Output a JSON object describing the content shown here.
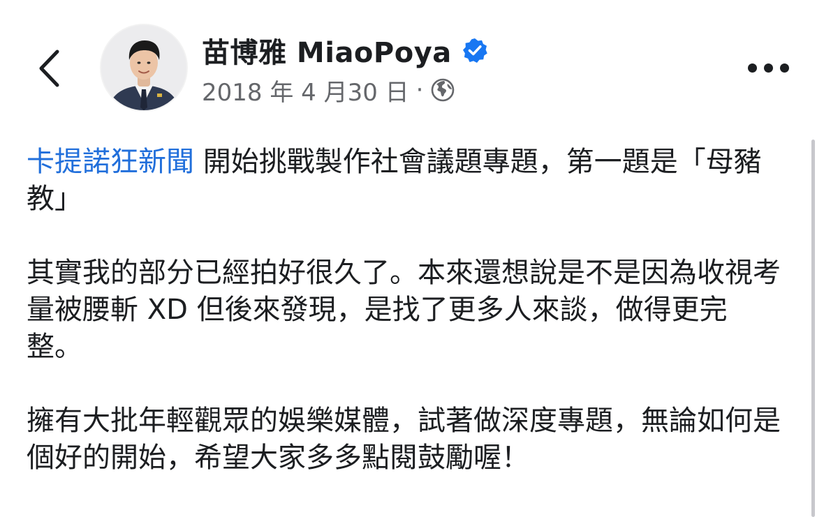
{
  "header": {
    "author_name": "苗博雅 MiaoPoya",
    "post_date": "2018 年 4 月30 日",
    "meta_separator": "·",
    "icons": {
      "back": "chevron-left-icon",
      "verified": "verified-badge-icon",
      "audience": "globe-icon",
      "more": "more-options-icon"
    }
  },
  "post": {
    "mention": "卡提諾狂新聞",
    "paragraph1_rest": " 開始挑戰製作社會議題專題，第一題是「母豬教」",
    "paragraph2": "其實我的部分已經拍好很久了。本來還想說是不是因為收視考量被腰斬 XD 但後來發現，是找了更多人來談，做得更完整。",
    "paragraph3": "擁有大批年輕觀眾的娛樂媒體，試著做深度專題，無論如何是個好的開始，希望大家多多點閱鼓勵喔！"
  },
  "colors": {
    "link": "#216fdb",
    "verified": "#1877f2",
    "secondary_text": "#65676b",
    "primary_text": "#1c1e21"
  }
}
